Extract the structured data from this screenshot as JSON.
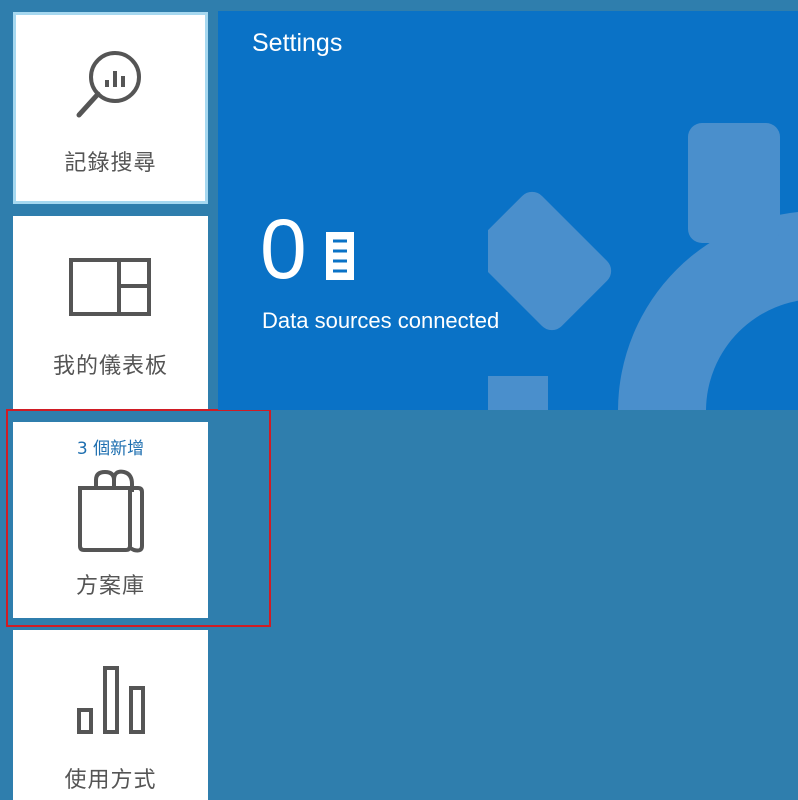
{
  "sidebar": {
    "tiles": [
      {
        "label": "記錄搜尋",
        "icon": "log-search-icon"
      },
      {
        "label": "我的儀表板",
        "icon": "dashboard-icon"
      },
      {
        "label": "方案庫",
        "icon": "shopping-bag-icon",
        "badge": "3 個新增"
      },
      {
        "label": "使用方式",
        "icon": "bar-chart-icon"
      }
    ]
  },
  "settings": {
    "title": "Settings",
    "count": "0",
    "count_label": "Data sources connected",
    "icon": "server-icon",
    "background_icon": "gear-icon"
  },
  "colors": {
    "background": "#2f7ead",
    "settings_tile": "#0a72c6",
    "badge": "#1e6fb0",
    "highlight": "#d01c24",
    "selected_border": "#a6d8f0"
  }
}
